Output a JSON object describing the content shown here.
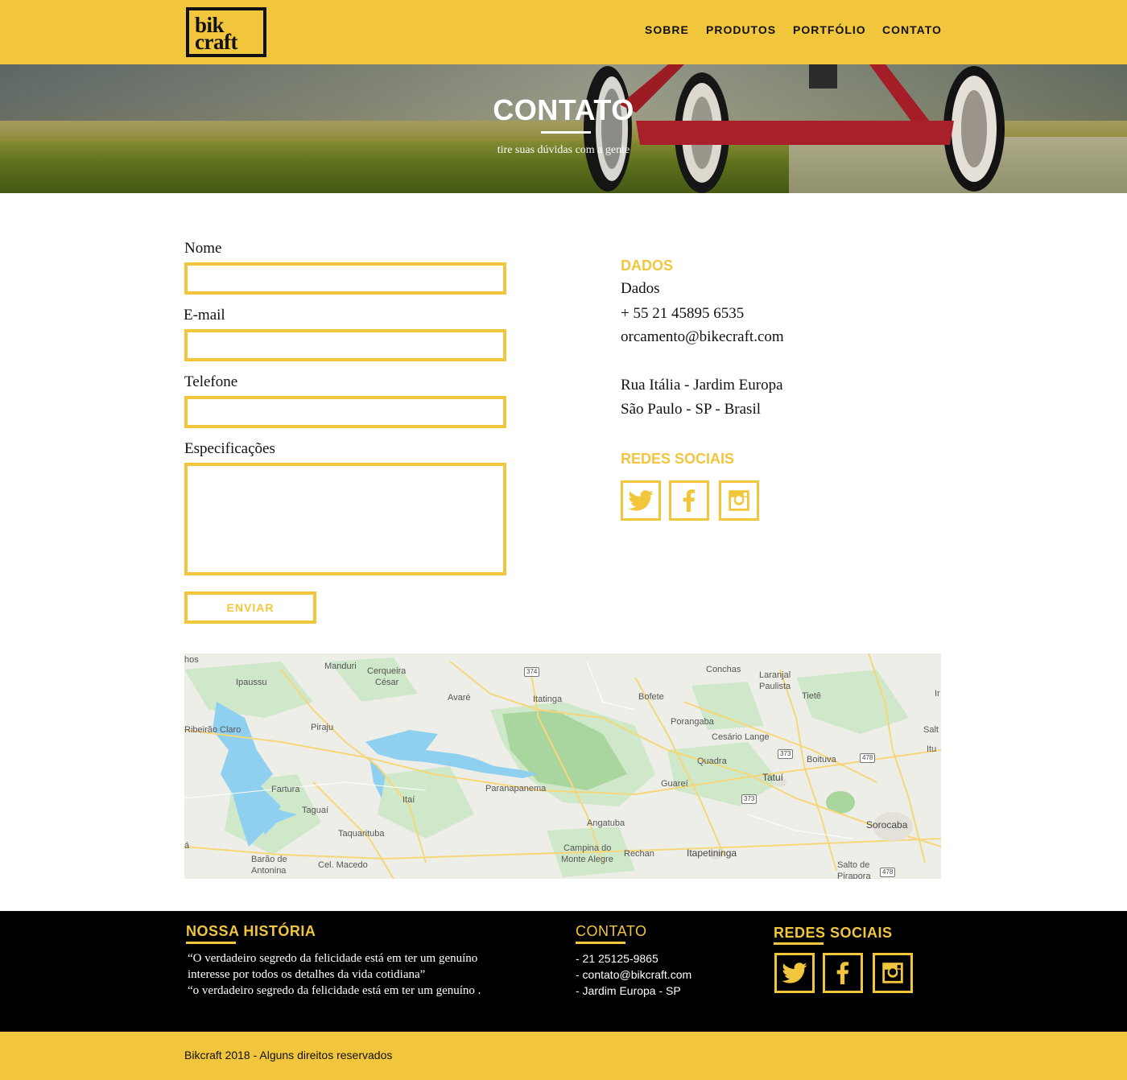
{
  "logo": {
    "line1": "bik",
    "line2": "craft"
  },
  "nav": [
    {
      "label": "SOBRE"
    },
    {
      "label": "PRODUTOS"
    },
    {
      "label": "PORTFÓLIO"
    },
    {
      "label": "CONTATO"
    }
  ],
  "hero": {
    "title": "CONTATO",
    "subtitle": "tire suas dúvidas com a gente"
  },
  "form": {
    "fields": [
      {
        "label": "Nome",
        "value": ""
      },
      {
        "label": "E-mail",
        "value": ""
      },
      {
        "label": "Telefone",
        "value": ""
      },
      {
        "label": "Especificações",
        "value": ""
      }
    ],
    "submit_label": "ENVIAR"
  },
  "dados": {
    "heading": "DADOS",
    "lines": [
      "Dados",
      "+ 55 21 45895 6535",
      "orcamento@bikecraft.com"
    ],
    "address": [
      "Rua Itália -  Jardim Europa",
      "São Paulo - SP - Brasil"
    ]
  },
  "social": {
    "heading": "REDES SOCIAIS",
    "icons": [
      "twitter-icon",
      "facebook-icon",
      "instagram-icon"
    ]
  },
  "map": {
    "labels": [
      "hos",
      "Manduri",
      "Cerqueira",
      "César",
      "Ipaussu",
      "Avaré",
      "Itatinga",
      "Conchas",
      "Laranjal",
      "Paulista",
      "Bofete",
      "Tietê",
      "Ribeirão Claro",
      "Piraju",
      "Porangaba",
      "Cesário Lange",
      "Salt",
      "Itu",
      "Quadra",
      "Boituva",
      "Fartura",
      "Paranapanema",
      "Guareí",
      "Tatuí",
      "Itaí",
      "Taguaí",
      "Angatuba",
      "Sorocaba",
      "Taquarituba",
      "Campina do",
      "Monte Alegre",
      "Rechan",
      "Itapetininga",
      "Barão de",
      "Antonina",
      "Cel. Macedo",
      "Salto de",
      "Pirapora",
      "á",
      "Ir"
    ],
    "shields": [
      "374",
      "373",
      "478",
      "373",
      "478"
    ]
  },
  "footer": {
    "historia_heading": "NOSSA HISTÓRIA",
    "quote": [
      "“O verdadeiro segredo da felicidade está em ter um genuíno",
      "interesse por todos os detalhes da vida cotidiana”",
      "“o verdadeiro segredo da felicidade está em ter um genuíno ."
    ],
    "contato_heading": "CONTATO",
    "contato": [
      "- 21 25125-9865",
      "- contato@bikcraft.com",
      "- Jardim Europa - SP"
    ],
    "redes_heading": "REDES SOCIAIS"
  },
  "copyright": "Bikcraft 2018 - Alguns direitos reservados",
  "colors": {
    "accent": "#f2c63c",
    "dark": "#000000"
  }
}
